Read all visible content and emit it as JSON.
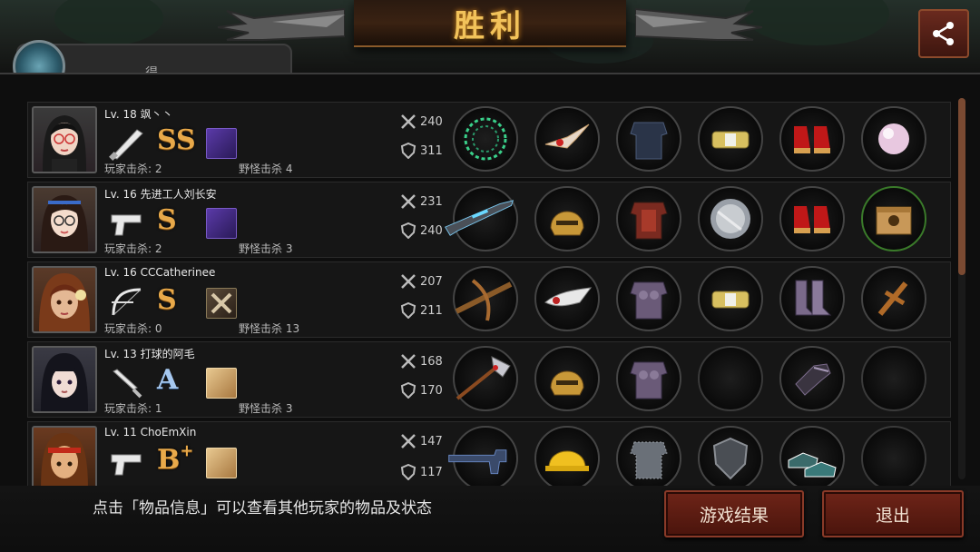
{
  "header": {
    "title": "胜利",
    "share_icon": "share-icon"
  },
  "tab": {
    "label": "得"
  },
  "players": [
    {
      "level": "Lv. 18 飒丶丶",
      "weapon": "bat-icon",
      "rank": "SS",
      "rank_plus": "",
      "skill": "purple-skill",
      "player_kills": "玩家击杀: 2",
      "monster_kills": "野怪击杀 4",
      "attack": "240",
      "defense": "311",
      "items": [
        "thorn-vine",
        "winged-tiara",
        "dark-armor",
        "gold-bracelet",
        "red-heels",
        "pearl"
      ]
    },
    {
      "level": "Lv. 16 先进工人刘长安",
      "weapon": "pistol-icon",
      "rank": "S",
      "rank_plus": "",
      "skill": "purple-skill",
      "player_kills": "玩家击杀: 2",
      "monster_kills": "野怪击杀 3",
      "attack": "231",
      "defense": "240",
      "items": [
        "energy-rifle",
        "gold-helmet",
        "red-armor",
        "silver-disc",
        "red-heels",
        "treasure-box"
      ]
    },
    {
      "level": "Lv. 16 CCCatherinee",
      "weapon": "bow-icon",
      "rank": "S",
      "rank_plus": "",
      "skill": "cross-skill",
      "player_kills": "玩家击杀: 0",
      "monster_kills": "野怪击杀 13",
      "attack": "207",
      "defense": "211",
      "items": [
        "crossbow",
        "red-headband",
        "stone-armor",
        "gold-bracelet",
        "purple-boots",
        "wooden-cross"
      ]
    },
    {
      "level": "Lv. 13 打球的阿毛",
      "weapon": "knife-icon",
      "rank": "A",
      "rank_plus": "",
      "skill": "fist-skill",
      "player_kills": "玩家击杀: 1",
      "monster_kills": "野怪击杀 3",
      "attack": "168",
      "defense": "170",
      "items": [
        "battle-axe",
        "gold-helmet",
        "stone-armor",
        "",
        "dark-gauntlet",
        ""
      ]
    },
    {
      "level": "Lv. 11 ChoEmXin",
      "weapon": "pistol-icon",
      "rank": "B",
      "rank_plus": "+",
      "skill": "fist-skill",
      "player_kills": "",
      "monster_kills": "",
      "attack": "147",
      "defense": "117",
      "items": [
        "revolver",
        "hard-hat",
        "chain-mail",
        "steel-shield",
        "green-sneakers",
        ""
      ]
    }
  ],
  "footer": {
    "hint": "点击「物品信息」可以查看其他玩家的物品及状态",
    "result_button": "游戏结果",
    "exit_button": "退出"
  },
  "colors": {
    "accent": "#f2c25a",
    "button": "#6e2418"
  }
}
